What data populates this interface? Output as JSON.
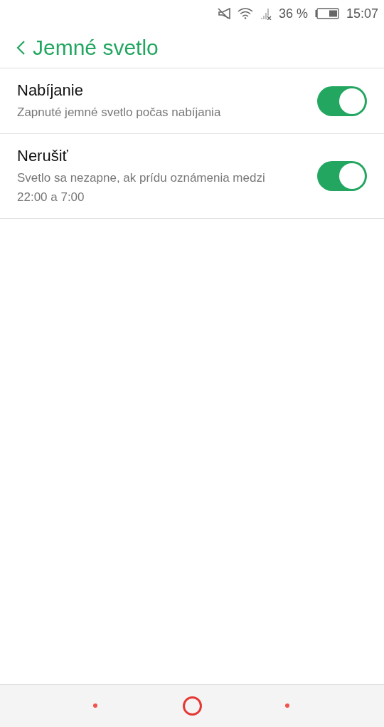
{
  "status_bar": {
    "battery_percent": "36 %",
    "time": "15:07"
  },
  "header": {
    "title": "Jemné svetlo"
  },
  "settings": [
    {
      "title": "Nabíjanie",
      "description": "Zapnuté jemné svetlo počas nabíjania",
      "on": true
    },
    {
      "title": "Nerušiť",
      "description": "Svetlo sa nezapne, ak prídu oznámenia medzi 22:00 a 7:00",
      "on": true
    }
  ]
}
